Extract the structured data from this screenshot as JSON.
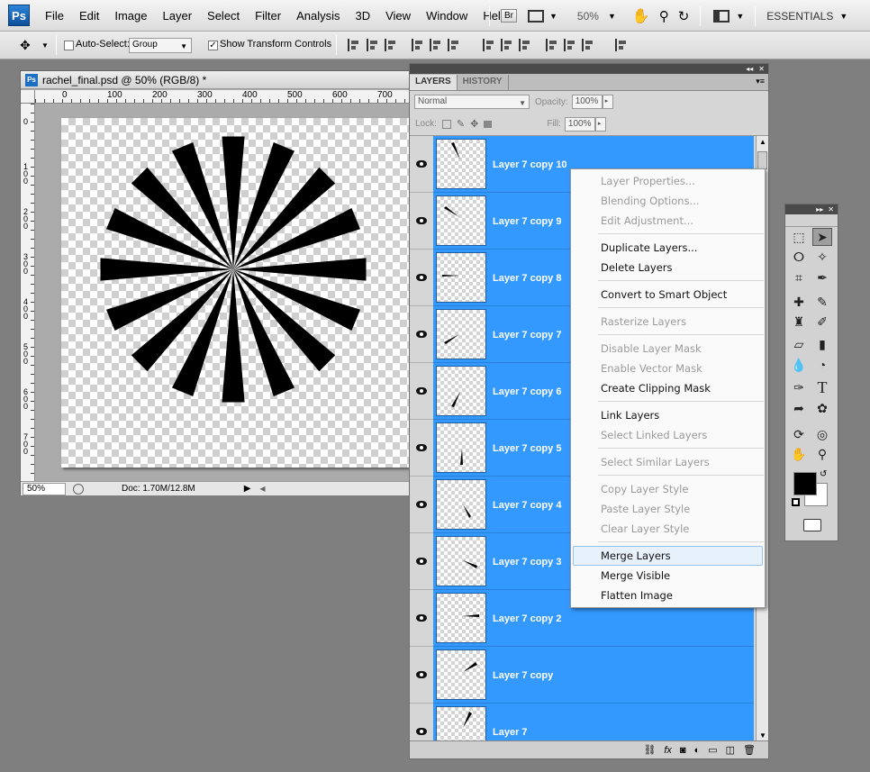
{
  "menubar": {
    "logo": "Ps",
    "items": [
      "File",
      "Edit",
      "Image",
      "Layer",
      "Select",
      "Filter",
      "Analysis",
      "3D",
      "View",
      "Window",
      "Help"
    ],
    "bridge": "Br",
    "zoom": "50%",
    "workspace": "ESSENTIALS"
  },
  "options": {
    "auto_select_label": "Auto-Select:",
    "auto_select_value": "Group",
    "transform_label": "Show Transform Controls",
    "transform_check": "✓"
  },
  "document": {
    "title": "rachel_final.psd @ 50% (RGB/8) *",
    "ruler_top": [
      "0",
      "100",
      "200",
      "300",
      "400",
      "500",
      "600",
      "700"
    ],
    "ruler_left": [
      "0",
      "1\n0\n0",
      "2\n0\n0",
      "3\n0\n0",
      "4\n0\n0",
      "5\n0\n0",
      "6\n0\n0",
      "7\n0\n0"
    ],
    "zoom": "50%",
    "doc_info": "Doc: 1.70M/12.8M"
  },
  "layers_panel": {
    "tabs": [
      "LAYERS",
      "HISTORY"
    ],
    "blend_mode": "Normal",
    "opacity_label": "Opacity:",
    "opacity_value": "100%",
    "lock_label": "Lock:",
    "fill_label": "Fill:",
    "fill_value": "100%",
    "layers": [
      "Layer 7 copy 10",
      "Layer 7 copy 9",
      "Layer 7 copy 8",
      "Layer 7 copy 7",
      "Layer 7 copy 6",
      "Layer 7 copy 5",
      "Layer 7 copy 4",
      "Layer 7 copy 3",
      "Layer 7 copy 2",
      "Layer 7 copy",
      "Layer 7"
    ]
  },
  "context_menu": {
    "items": [
      {
        "label": "Layer Properties...",
        "enabled": false
      },
      {
        "label": "Blending Options...",
        "enabled": false
      },
      {
        "label": "Edit Adjustment...",
        "enabled": false
      },
      {
        "label": "Duplicate Layers...",
        "enabled": true
      },
      {
        "label": "Delete Layers",
        "enabled": true
      },
      {
        "label": "Convert to Smart Object",
        "enabled": true
      },
      {
        "label": "Rasterize Layers",
        "enabled": false
      },
      {
        "label": "Disable Layer Mask",
        "enabled": false
      },
      {
        "label": "Enable Vector Mask",
        "enabled": false
      },
      {
        "label": "Create Clipping Mask",
        "enabled": true
      },
      {
        "label": "Link Layers",
        "enabled": true
      },
      {
        "label": "Select Linked Layers",
        "enabled": false
      },
      {
        "label": "Select Similar Layers",
        "enabled": false
      },
      {
        "label": "Copy Layer Style",
        "enabled": false
      },
      {
        "label": "Paste Layer Style",
        "enabled": false
      },
      {
        "label": "Clear Layer Style",
        "enabled": false
      },
      {
        "label": "Merge Layers",
        "enabled": true,
        "highlighted": true
      },
      {
        "label": "Merge Visible",
        "enabled": true
      },
      {
        "label": "Flatten Image",
        "enabled": true
      }
    ]
  },
  "tools": {
    "icons": [
      "marquee-icon",
      "move-icon",
      "lasso-icon",
      "magic-wand-icon",
      "crop-icon",
      "eyedropper-icon",
      "healing-brush-icon",
      "brush-icon",
      "clone-stamp-icon",
      "history-brush-icon",
      "eraser-icon",
      "gradient-icon",
      "blur-icon",
      "dodge-icon",
      "pen-icon",
      "type-icon",
      "path-selection-icon",
      "shape-icon",
      "3d-rotate-icon",
      "3d-orbit-icon",
      "hand-icon",
      "zoom-icon"
    ],
    "type_glyph": "T",
    "foreground": "#000000",
    "background": "#ffffff"
  }
}
